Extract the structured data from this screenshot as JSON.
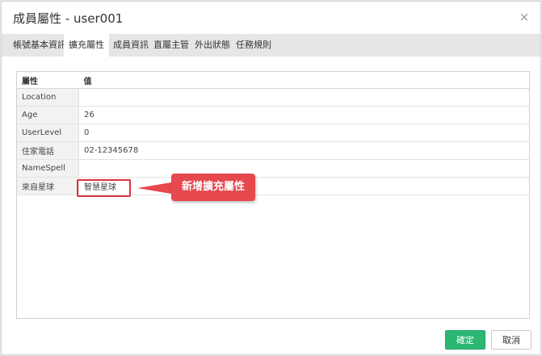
{
  "dialog": {
    "title": "成員屬性 - user001",
    "close_glyph": "×"
  },
  "tabs": [
    {
      "label": "帳號基本資訊",
      "active": false
    },
    {
      "label": "擴充屬性",
      "active": true
    },
    {
      "label": "成員資訊",
      "active": false
    },
    {
      "label": "直屬主管",
      "active": false
    },
    {
      "label": "外出狀態",
      "active": false
    },
    {
      "label": "任務規則",
      "active": false
    }
  ],
  "table": {
    "headers": [
      "屬性",
      "值"
    ],
    "rows": [
      {
        "key": "Location",
        "value": ""
      },
      {
        "key": "Age",
        "value": "26"
      },
      {
        "key": "UserLevel",
        "value": "0"
      },
      {
        "key": "住家電話",
        "value": "02-12345678"
      },
      {
        "key": "NameSpell",
        "value": ""
      },
      {
        "key": "來自星球",
        "value": "智慧星球"
      }
    ]
  },
  "annotation": {
    "callout_text": "新增擴充屬性",
    "color": "#e5484d"
  },
  "buttons": {
    "ok_label": "確定",
    "cancel_label": "取消"
  },
  "colors": {
    "accent": "#2bb673",
    "tabbar_bg": "#e6e6e6"
  }
}
